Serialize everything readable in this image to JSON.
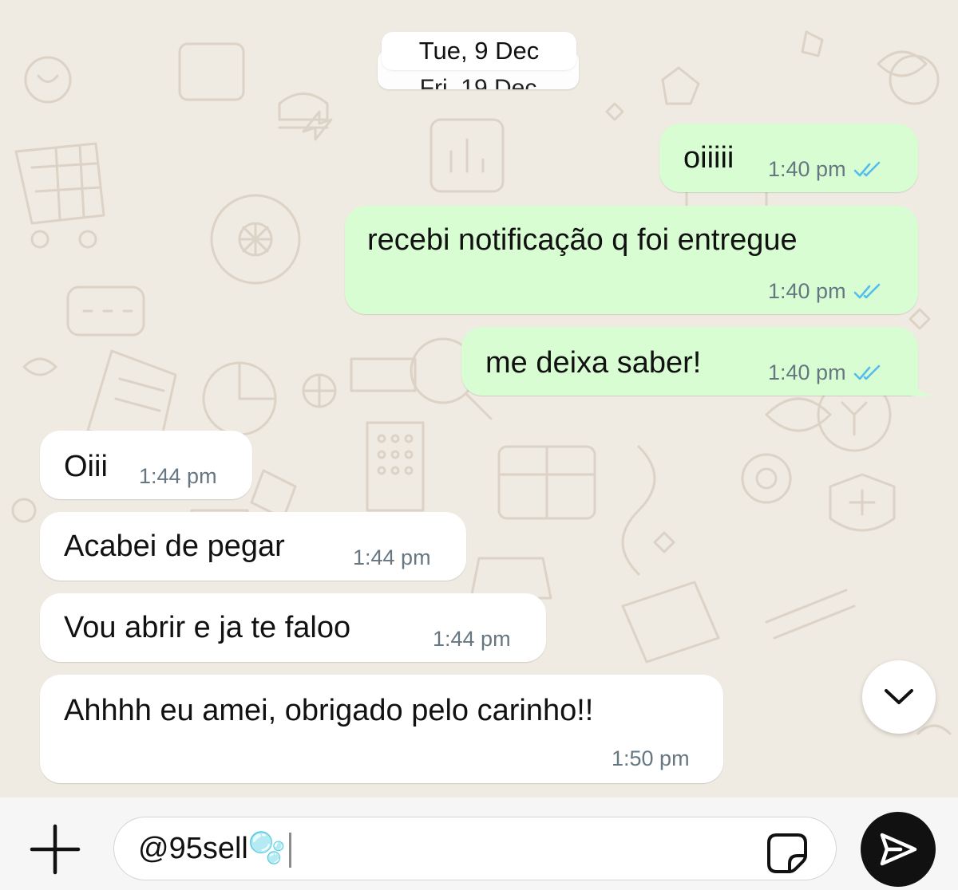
{
  "chat": {
    "date_separator": "Tue, 9 Dec",
    "date_separator_behind": "Fri, 19 Dec",
    "messages": [
      {
        "direction": "outgoing",
        "text": "oiiiii",
        "time": "1:40 pm",
        "status": "read"
      },
      {
        "direction": "outgoing",
        "text": "recebi notificação q foi entregue",
        "time": "1:40 pm",
        "status": "read"
      },
      {
        "direction": "outgoing",
        "text": "me deixa saber!",
        "time": "1:40 pm",
        "status": "read"
      },
      {
        "direction": "incoming",
        "text": "Oiii",
        "time": "1:44 pm"
      },
      {
        "direction": "incoming",
        "text": "Acabei de pegar",
        "time": "1:44 pm"
      },
      {
        "direction": "incoming",
        "text": "Vou abrir e ja te faloo",
        "time": "1:44 pm"
      },
      {
        "direction": "incoming",
        "text": "Ahhhh eu amei, obrigado pelo carinho!!",
        "time": "1:50 pm"
      }
    ]
  },
  "composer": {
    "input_value": "@95sell🫧",
    "icons": {
      "attach": "plus-icon",
      "sticker": "sticker-icon",
      "send": "send-icon",
      "scroll_down": "chevron-down-icon"
    }
  },
  "colors": {
    "background": "#efeae2",
    "outgoing_bubble": "#d9fdd3",
    "incoming_bubble": "#ffffff",
    "read_ticks": "#53bdeb",
    "timestamp": "#667781",
    "send_button": "#111111"
  }
}
